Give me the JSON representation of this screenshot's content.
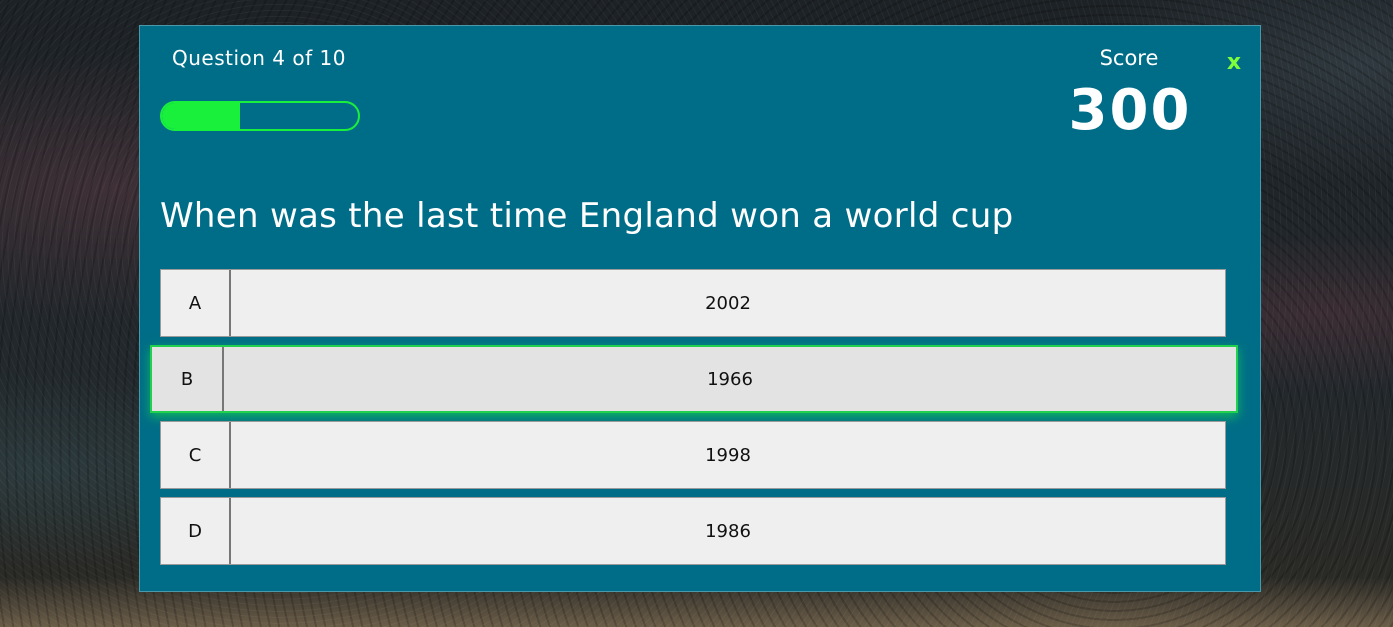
{
  "header": {
    "question_counter": "Question 4 of 10",
    "progress_fraction": 0.4,
    "score_label": "Score",
    "score_value": "300",
    "close_label": "x"
  },
  "question": {
    "text": "When was the last time England won a world cup"
  },
  "answers": [
    {
      "letter": "A",
      "text": "2002"
    },
    {
      "letter": "B",
      "text": "1966",
      "highlighted": true
    },
    {
      "letter": "C",
      "text": "1998"
    },
    {
      "letter": "D",
      "text": "1986"
    }
  ],
  "colors": {
    "panel": "#006d88",
    "progress": "#19f03c",
    "close": "#7fff3a",
    "answer_bg": "#efefef",
    "highlight_border": "#21d04e"
  }
}
